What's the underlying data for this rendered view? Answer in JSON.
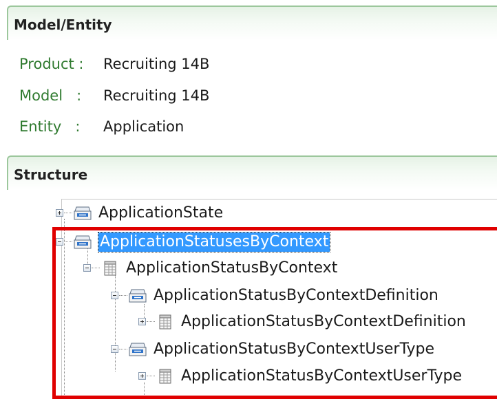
{
  "model_entity": {
    "title": "Model/Entity",
    "rows": [
      {
        "label": "Product :",
        "value": "Recruiting 14B"
      },
      {
        "label": "Model   :",
        "value": "Recruiting 14B"
      },
      {
        "label": "Entity   :",
        "value": "Application"
      }
    ]
  },
  "structure": {
    "title": "Structure",
    "nodes": [
      {
        "label": "ApplicationState",
        "icon": "collection-icon",
        "expander": "plus",
        "selected": false
      },
      {
        "label": "ApplicationStatusesByContext",
        "icon": "collection-icon",
        "expander": "minus",
        "selected": true
      },
      {
        "label": "ApplicationStatusByContext",
        "icon": "table-icon",
        "expander": "minus",
        "selected": false
      },
      {
        "label": "ApplicationStatusByContextDefinition",
        "icon": "collection-icon",
        "expander": "minus",
        "selected": false
      },
      {
        "label": "ApplicationStatusByContextDefinition",
        "icon": "table-icon",
        "expander": "plus",
        "selected": false
      },
      {
        "label": "ApplicationStatusByContextUserType",
        "icon": "collection-icon",
        "expander": "minus",
        "selected": false
      },
      {
        "label": "ApplicationStatusByContextUserType",
        "icon": "table-icon",
        "expander": "plus",
        "selected": false
      }
    ]
  },
  "colors": {
    "label_green": "#2f7a2f",
    "selection_blue": "#3399ff",
    "highlight_red": "#e00000",
    "header_border": "#9cc79c"
  }
}
